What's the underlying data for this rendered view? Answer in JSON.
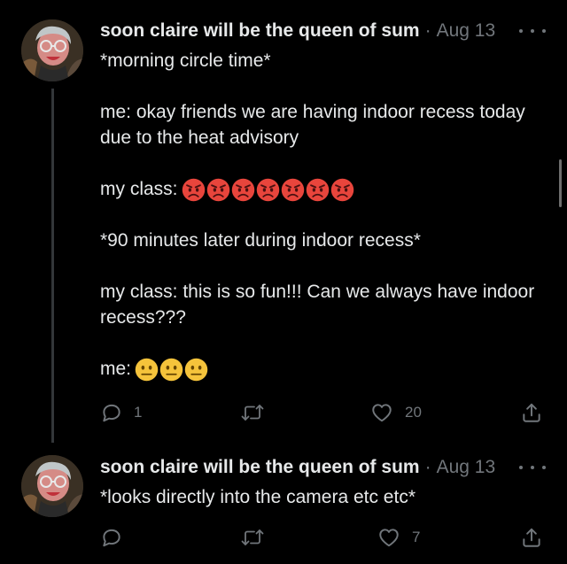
{
  "tweets": [
    {
      "author": "soon claire will be the queen of sum",
      "separator": "·",
      "date": "Aug 13",
      "lines": [
        "*morning circle time*",
        "",
        "me: okay friends we are having indoor recess today due to the heat advisory",
        "",
        "my class:",
        "",
        "*90 minutes later during indoor recess*",
        "",
        "my class: this is so fun!!! Can we always have indoor recess???",
        "",
        "me:"
      ],
      "emoji": {
        "my_class": "pouting-face",
        "my_class_count": 7,
        "me": "neutral-face",
        "me_count": 3
      },
      "reply_count": "1",
      "retweet_count": "",
      "like_count": "20"
    },
    {
      "author": "soon claire will be the queen of sum",
      "separator": "·",
      "date": "Aug 13",
      "lines": [
        "*looks directly into the camera etc etc*"
      ],
      "reply_count": "",
      "retweet_count": "",
      "like_count": "7"
    }
  ],
  "icons": {
    "reply": "reply-icon",
    "retweet": "retweet-icon",
    "like": "heart-icon",
    "share": "share-icon",
    "more": "more-icon"
  },
  "colors": {
    "background": "#000000",
    "text": "#e7e9ea",
    "muted": "#71767b",
    "pouting": "#e8453c",
    "neutral": "#f5c33b"
  }
}
